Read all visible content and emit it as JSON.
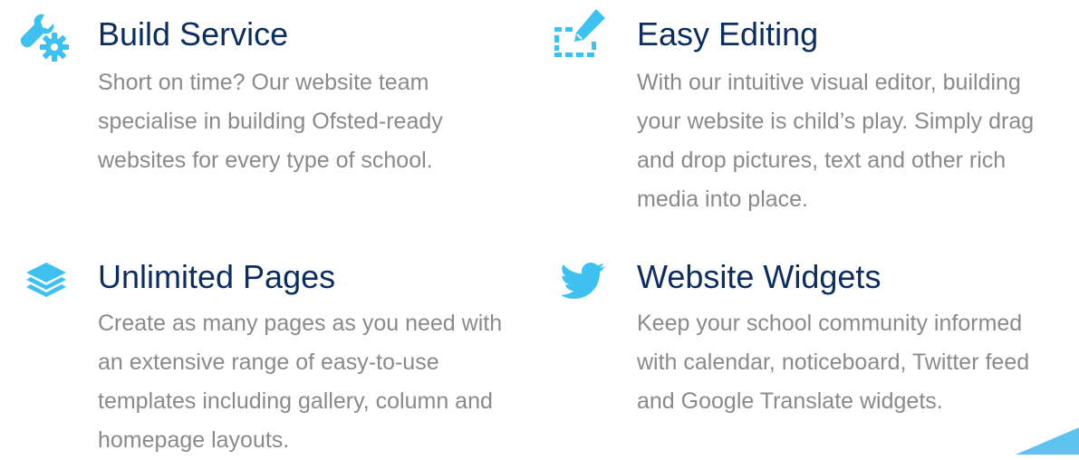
{
  "colors": {
    "accent": "#3ec1ef",
    "heading": "#0c2d5e",
    "body_text": "#8a8a8a"
  },
  "features": [
    {
      "icon": "wrench-gear-icon",
      "title": "Build Service",
      "description": "Short on time? Our website team specialise in building Ofsted-ready websites for every type of school."
    },
    {
      "icon": "edit-selection-icon",
      "title": "Easy Editing",
      "description": "With our intuitive visual editor, building your website is child’s play. Simply drag and drop pictures, text and other rich media into place."
    },
    {
      "icon": "layers-icon",
      "title": "Unlimited Pages",
      "description": "Create as many pages as you need with an extensive range of easy-to-use templates including gallery, column and homepage layouts."
    },
    {
      "icon": "twitter-bird-icon",
      "title": "Website Widgets",
      "description": "Keep your school community informed with calendar, noticeboard, Twitter feed and Google Translate widgets."
    }
  ]
}
